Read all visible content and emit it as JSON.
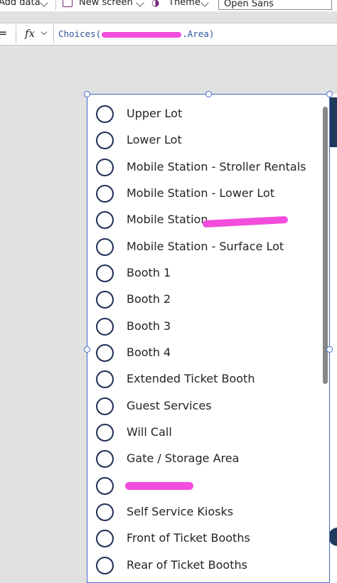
{
  "toolbar": {
    "add_data_label": "Add data",
    "new_screen_label": "New screen",
    "theme_label": "Theme",
    "font_value": "Open Sans"
  },
  "formula_bar": {
    "equals": "=",
    "fx_label": "fx",
    "formula_prefix": "Choices(",
    "formula_suffix": ".Area)"
  },
  "radio": {
    "options": [
      {
        "label": "Upper Lot"
      },
      {
        "label": "Lower Lot"
      },
      {
        "label": "Mobile Station - Stroller Rentals"
      },
      {
        "label": "Mobile Station - Lower Lot"
      },
      {
        "label": "Mobile Station"
      },
      {
        "label": "Mobile Station - Surface Lot"
      },
      {
        "label": "Booth 1"
      },
      {
        "label": "Booth 2"
      },
      {
        "label": "Booth 3"
      },
      {
        "label": "Booth 4"
      },
      {
        "label": "Extended Ticket Booth"
      },
      {
        "label": "Guest Services"
      },
      {
        "label": "Will Call"
      },
      {
        "label": "Gate / Storage Area"
      },
      {
        "label": ""
      },
      {
        "label": "Self Service Kiosks"
      },
      {
        "label": "Front of Ticket Booths"
      },
      {
        "label": "Rear of Ticket Booths"
      }
    ]
  },
  "colors": {
    "selection": "#3f6ac9",
    "radio_border": "#1f2f57",
    "redaction": "#f24ddc",
    "formula_text": "#2f5597"
  }
}
